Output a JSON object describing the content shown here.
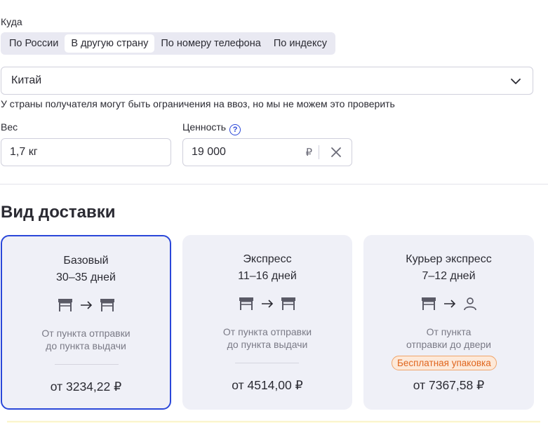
{
  "destination": {
    "label": "Куда",
    "tabs": [
      {
        "label": "По России",
        "active": false
      },
      {
        "label": "В другую страну",
        "active": true
      },
      {
        "label": "По номеру телефона",
        "active": false
      },
      {
        "label": "По индексу",
        "active": false
      }
    ],
    "country": "Китай",
    "hint": "У страны получателя могут быть ограничения на ввоз, но мы не можем это проверить"
  },
  "weight": {
    "label": "Вес",
    "value": "1,7 кг"
  },
  "value": {
    "label": "Ценность",
    "amount": "19 000",
    "currency": "₽",
    "help_icon": "?"
  },
  "delivery": {
    "heading": "Вид доставки",
    "options": [
      {
        "title": "Базовый",
        "days": "30–35 дней",
        "desc_line1": "От пункта отправки",
        "desc_line2": "до пункта выдачи",
        "price": "от 3234,22 ₽",
        "selected": true,
        "to_icon": "store-icon"
      },
      {
        "title": "Экспресс",
        "days": "11–16 дней",
        "desc_line1": "От пункта отправки",
        "desc_line2": "до пункта выдачи",
        "price": "от 4514,00 ₽",
        "selected": false,
        "to_icon": "store-icon"
      },
      {
        "title": "Курьер экспресс",
        "days": "7–12 дней",
        "desc_line1": "От пункта",
        "desc_line2": "отправки до двери",
        "badge": "Бесплатная упаковка",
        "price": "от 7367,58 ₽",
        "selected": false,
        "to_icon": "person-icon"
      }
    ]
  },
  "colors": {
    "accent": "#2a47d9",
    "card_bg": "#eff0f7",
    "badge_text": "#e0661e",
    "badge_bg": "#fde9d9"
  }
}
